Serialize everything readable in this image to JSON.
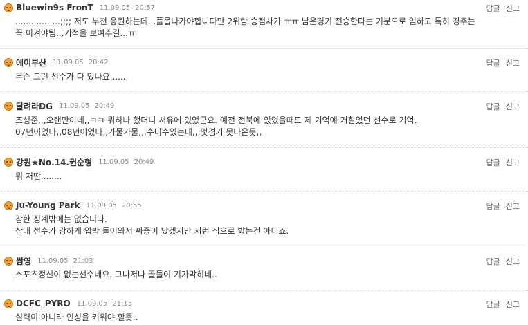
{
  "actions": {
    "reply": "답글",
    "report": "신고"
  },
  "comments": [
    {
      "nick": "Bluewin9s FronT",
      "date": "11.09.05",
      "time": "20:57",
      "lines": [
        ".................;;;; 저도 부천 응원하는데...플옵나가야합니다만 2위랑 승점차가 ㅠㅠ 남은경기 전승한다는 기분으로 임하고 특히 경주는",
        "꼭 이겨야팀...기적을 보여주길...ㅠ"
      ]
    },
    {
      "nick": "에이부산",
      "date": "11.09.05",
      "time": "20:42",
      "lines": [
        "무슨 그런 선수가 다 있나요......."
      ]
    },
    {
      "nick": "달려라DG",
      "date": "11.09.05",
      "time": "20:49",
      "lines": [
        "조성준,,,오랜만이네,,ㅋㅋ 뭐하나 했더니 서유에 있었군요. 예전 전북에 있었을때도 제 기억에 거칠었던 선수로 기억.",
        "07년이었나,,08년이었나,,가물가물,,,수비수였는데,,,몇경기 못나온듯,,"
      ]
    },
    {
      "nick": "강원★No.14.권순형",
      "date": "11.09.05",
      "time": "20:49",
      "lines": [
        "뭐 저딴........"
      ]
    },
    {
      "nick": "Ju-Young Park",
      "date": "11.09.05",
      "time": "20:55",
      "lines": [
        "강한 징계밖에는 없습니다.",
        "상대 선수가 강하게 압박 들어와서 짜증이 났겠지만 저런 식으로 밟는건 아니죠."
      ]
    },
    {
      "nick": "쌈영",
      "date": "11.09.05",
      "time": "21:03",
      "lines": [
        "스포츠정신이 없는선수네요. 그나저나 골들이 기가막히네.."
      ]
    },
    {
      "nick": "DCFC_PYRO",
      "date": "11.09.05",
      "time": "21:15",
      "lines": [
        "실력이 아니라 인성을 키워야 할듯.."
      ]
    }
  ]
}
